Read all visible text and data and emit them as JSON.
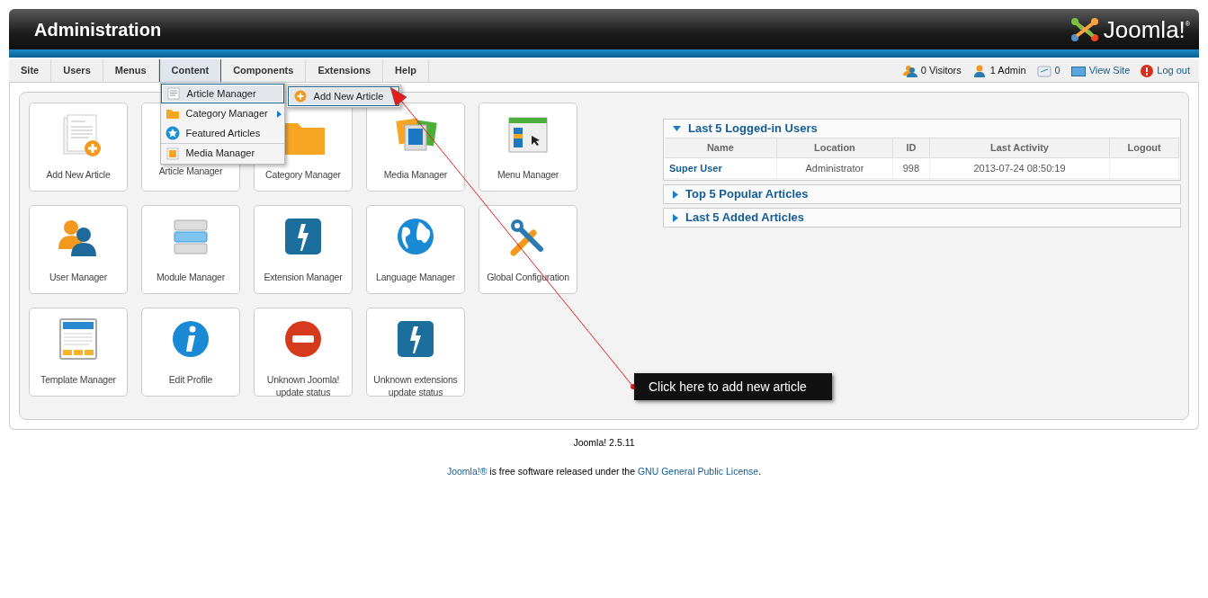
{
  "header": {
    "title": "Administration",
    "logo_text": "Joomla!$^{®}$"
  },
  "menu": [
    {
      "label": "Site",
      "selected": false
    },
    {
      "label": "Users",
      "selected": false
    },
    {
      "label": "Menus",
      "selected": false
    },
    {
      "label": "Content",
      "selected": true
    },
    {
      "label": "Components",
      "selected": false
    },
    {
      "label": "Extensions",
      "selected": false
    },
    {
      "label": "Help",
      "selected": false
    }
  ],
  "dropdown": [
    {
      "label": "Article Manager",
      "kind": "article",
      "selected": true,
      "submenu": false,
      "separator": false
    },
    {
      "label": "Category Manager",
      "kind": "folder",
      "selected": false,
      "submenu": true,
      "separator": false
    },
    {
      "label": "Featured Articles",
      "kind": "star",
      "selected": false,
      "submenu": false,
      "separator": false
    },
    {
      "label": "Media Manager",
      "kind": "media",
      "selected": false,
      "submenu": false,
      "separator": true
    }
  ],
  "submenu": [
    {
      "label": "Add New Article",
      "selected": true
    }
  ],
  "status": [
    {
      "label": "0 Visitors",
      "kind": "visitors"
    },
    {
      "label": "1 Admin",
      "kind": "admin"
    },
    {
      "label": "0",
      "kind": "messages"
    },
    {
      "label": "View Site",
      "kind": "site"
    },
    {
      "label": "Log out",
      "kind": "logout"
    }
  ],
  "tiles": [
    {
      "label": "Add New Article",
      "kind": "add-article"
    },
    {
      "label": "Article Manager"
    },
    {
      "label": "Category Manager",
      "kind": "folder"
    },
    {
      "label": "Media Manager",
      "kind": "media"
    },
    {
      "label": "Menu Manager",
      "kind": "menu"
    },
    {
      "label": "User Manager",
      "kind": "users"
    },
    {
      "label": "Module Manager",
      "kind": "module"
    },
    {
      "label": "Extension Manager",
      "kind": "extension"
    },
    {
      "label": "Language Manager",
      "kind": "globe"
    },
    {
      "label": "Global Configuration",
      "kind": "tools"
    },
    {
      "label": "Template Manager",
      "kind": "template"
    },
    {
      "label": "Edit Profile",
      "kind": "info"
    },
    {
      "label": "Unknown Joomla! update status",
      "kind": "stop"
    },
    {
      "label": "Unknown extensions update status",
      "kind": "extension"
    }
  ],
  "panels": [
    {
      "title": "Last 5 Logged-in Users",
      "expanded": true,
      "table": {
        "columns": [
          "Name",
          "Location",
          "ID",
          "Last Activity",
          "Logout"
        ],
        "rows": [
          {
            "name": "Super User",
            "location": "Administrator",
            "id": "998",
            "last_activity": "2013-07-24 08:50:19"
          }
        ]
      }
    },
    {
      "title": "Top 5 Popular Articles",
      "expanded": false
    },
    {
      "title": "Last 5 Added Articles",
      "expanded": false
    }
  ],
  "callout": {
    "text": "Click here to add new article"
  },
  "footer": {
    "version": "Joomla! 2.5.11",
    "license": [
      {
        "text": "Joomla!®",
        "link": true
      },
      {
        "text": " is free software released under the ",
        "link": false
      },
      {
        "text": "GNU General Public License",
        "link": true
      },
      {
        "text": ".",
        "link": false
      }
    ]
  }
}
